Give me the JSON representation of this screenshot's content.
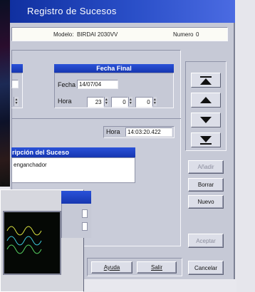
{
  "window": {
    "title": "Registro de Sucesos",
    "model_label": "Modelo:",
    "model_value": "BIRDAI 2030VV",
    "number_label": "Numero",
    "number_value": "0"
  },
  "fecha_final": {
    "header": "Fecha Final",
    "fecha_label": "Fecha",
    "fecha_value": "14/07/04",
    "hora_label": "Hora",
    "hora_h": "23",
    "hora_m": "0",
    "hora_s": "0"
  },
  "hora": {
    "label": "Hora",
    "value": "14:03:20.422"
  },
  "descripcion": {
    "header": "ripción del Suceso",
    "text": "enganchador"
  },
  "nav": {
    "buttons": [
      "first",
      "prev",
      "next",
      "last"
    ]
  },
  "actions": {
    "add": "Añadir",
    "delete": "Borrar",
    "new": "Nuevo",
    "accept": "Aceptar",
    "cancel": "Cancelar",
    "help": "Ayuda",
    "exit": "Salir"
  },
  "background": {
    "left_label": "y"
  }
}
